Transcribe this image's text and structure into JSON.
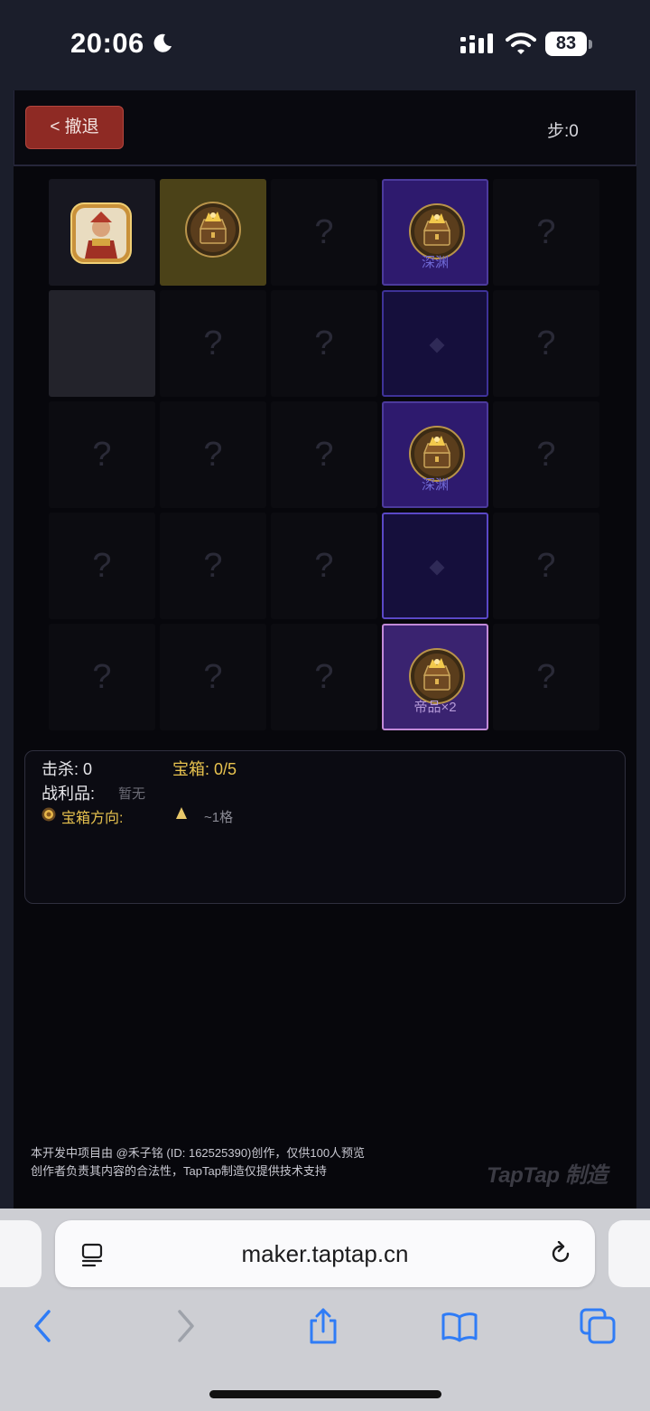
{
  "status_bar": {
    "time": "20:06",
    "battery": "83"
  },
  "game": {
    "undo_label": "< 撤退",
    "step_label": "步:0",
    "grid": {
      "rows": 5,
      "cols": 5,
      "unknown_glyph": "?",
      "cells": [
        {
          "row": 0,
          "col": 0,
          "type": "player"
        },
        {
          "row": 0,
          "col": 1,
          "type": "chest-gold"
        },
        {
          "row": 0,
          "col": 2,
          "type": "unknown"
        },
        {
          "row": 0,
          "col": 3,
          "type": "chest-purple",
          "label": "深渊"
        },
        {
          "row": 0,
          "col": 4,
          "type": "unknown"
        },
        {
          "row": 1,
          "col": 0,
          "type": "visited"
        },
        {
          "row": 1,
          "col": 1,
          "type": "unknown"
        },
        {
          "row": 1,
          "col": 2,
          "type": "unknown"
        },
        {
          "row": 1,
          "col": 3,
          "type": "path"
        },
        {
          "row": 1,
          "col": 4,
          "type": "unknown"
        },
        {
          "row": 2,
          "col": 0,
          "type": "unknown"
        },
        {
          "row": 2,
          "col": 1,
          "type": "unknown"
        },
        {
          "row": 2,
          "col": 2,
          "type": "unknown"
        },
        {
          "row": 2,
          "col": 3,
          "type": "chest-purple",
          "label": "深渊"
        },
        {
          "row": 2,
          "col": 4,
          "type": "unknown"
        },
        {
          "row": 3,
          "col": 0,
          "type": "unknown"
        },
        {
          "row": 3,
          "col": 1,
          "type": "unknown"
        },
        {
          "row": 3,
          "col": 2,
          "type": "unknown"
        },
        {
          "row": 3,
          "col": 3,
          "type": "path-bright"
        },
        {
          "row": 3,
          "col": 4,
          "type": "unknown"
        },
        {
          "row": 4,
          "col": 0,
          "type": "unknown"
        },
        {
          "row": 4,
          "col": 1,
          "type": "unknown"
        },
        {
          "row": 4,
          "col": 2,
          "type": "unknown"
        },
        {
          "row": 4,
          "col": 3,
          "type": "chest-pink",
          "label": "帝品×2"
        },
        {
          "row": 4,
          "col": 4,
          "type": "unknown"
        }
      ]
    },
    "info": {
      "kills": "击杀: 0",
      "chests": "宝箱: 0/5",
      "loot_label": "战利品:",
      "loot_value": "暂无",
      "direction_label": "宝箱方向:",
      "direction_distance": "~1格"
    },
    "footer": {
      "line1": "本开发中项目由 @禾子铭 (ID: 162525390)创作，仅供100人预览",
      "line2": "创作者负责其内容的合法性，TapTap制造仅提供技术支持",
      "brand": "TapTap 制造"
    }
  },
  "browser": {
    "url": "maker.taptap.cn"
  },
  "colors": {
    "background": "#07070c",
    "accent_gold": "#e8c34f",
    "undo_red": "#8e2a24",
    "purple": "#2e1a6e"
  },
  "icons": [
    "moon-icon",
    "signal-icon",
    "wifi-icon",
    "chest-icon",
    "hero-avatar",
    "reader-icon",
    "reload-icon",
    "back-icon",
    "forward-icon",
    "share-icon",
    "bookmarks-icon",
    "tabs-icon"
  ]
}
